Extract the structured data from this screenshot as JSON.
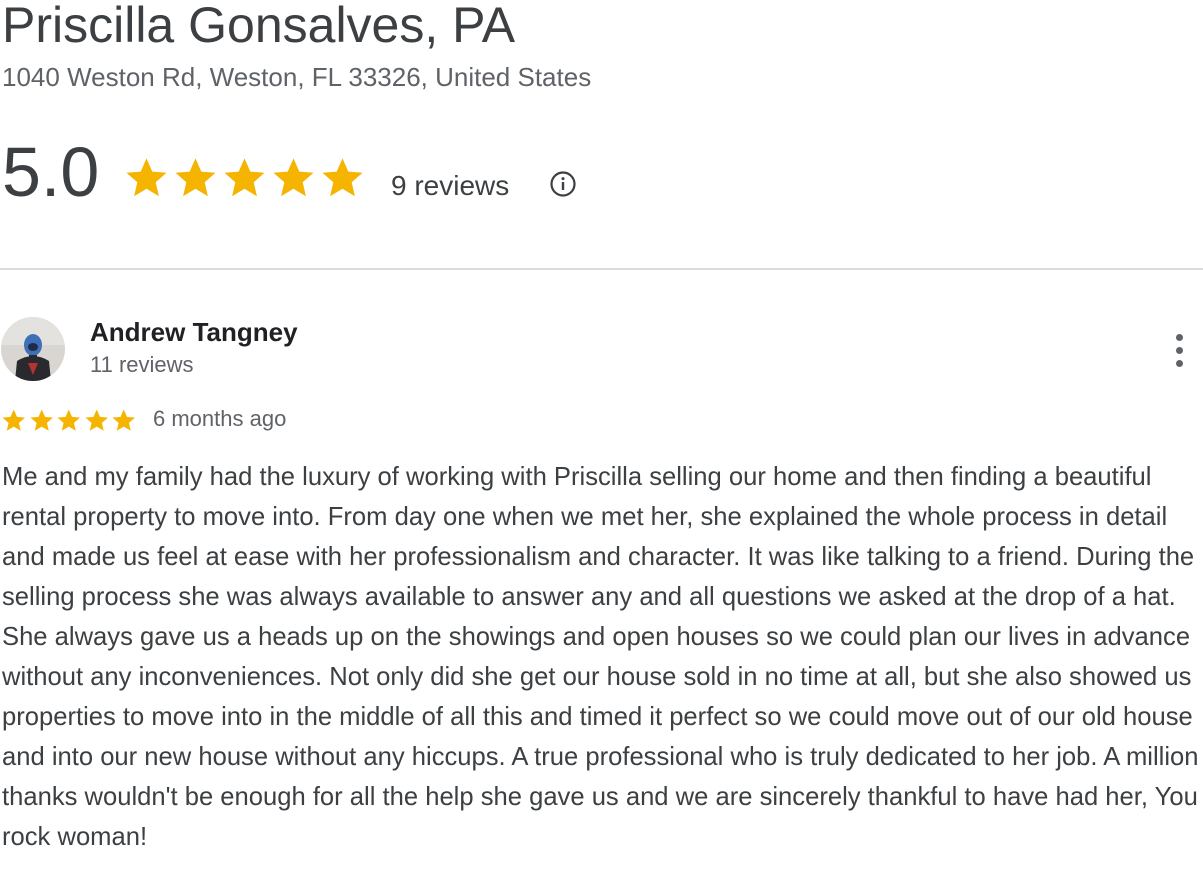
{
  "business": {
    "name": "Priscilla Gonsalves, PA",
    "address": "1040 Weston Rd, Weston, FL 33326, United States"
  },
  "summary": {
    "rating": "5.0",
    "stars": 5,
    "review_count": "9 reviews",
    "info_icon": "info-circle-icon"
  },
  "colors": {
    "star": "#F4B400",
    "text": "#3C4043",
    "secondary": "#5F6368",
    "divider": "#DADCE0"
  },
  "review": {
    "author": "Andrew Tangney",
    "author_reviews": "11 reviews",
    "stars": 5,
    "time": "6 months ago",
    "text": "Me and my family had the luxury of working with Priscilla selling our home and then finding a beautiful rental property to move into. From day one when we met her, she explained the whole process in detail and made us feel at ease with her professionalism and character. It was like talking to a friend. During the selling process she was always available to answer any and all questions we asked at the drop of a hat. She always gave us a heads up on the showings and open houses so we could plan our lives in advance without any inconveniences. Not only did she get our house sold in no time at all, but she also showed us properties to move into in the middle of all this and timed it perfect so we could move out of our old house and into our new house without any hiccups. A true professional who is truly dedicated to her job. A million thanks wouldn't be enough for all the help she gave us and we are sincerely thankful to have had her, You rock woman!",
    "more_icon": "more-vertical-icon"
  }
}
